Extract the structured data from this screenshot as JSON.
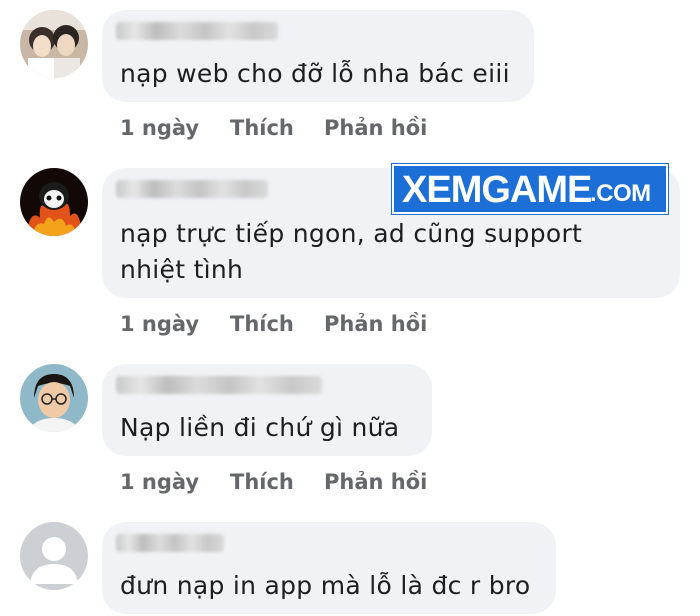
{
  "watermark": {
    "main": "XEMGAME",
    "suffix": ".COM",
    "color": "#1b6fd6"
  },
  "comments": [
    {
      "text_lines": [
        "nạp web cho đỡ lỗ nha bác eiii"
      ],
      "time": "1 ngày",
      "like": "Thích",
      "reply": "Phản hồi",
      "avatar": "anime-avatar"
    },
    {
      "text_lines": [
        "nạp trực tiếp ngon, ad cũng support",
        "nhiệt tình"
      ],
      "time": "1 ngày",
      "like": "Thích",
      "reply": "Phản hồi",
      "avatar": "sloth-fire-avatar"
    },
    {
      "text_lines": [
        "Nạp liền đi chứ gì nữa"
      ],
      "time": "1 ngày",
      "like": "Thích",
      "reply": "Phản hồi",
      "avatar": "boy-glasses-avatar"
    },
    {
      "text_lines": [
        "đưn nạp in app mà lỗ là đc r bro"
      ],
      "avatar": "default-avatar"
    }
  ],
  "colors": {
    "bubble": "#f0f2f5",
    "text": "#1c1e21",
    "meta": "#65676b"
  }
}
